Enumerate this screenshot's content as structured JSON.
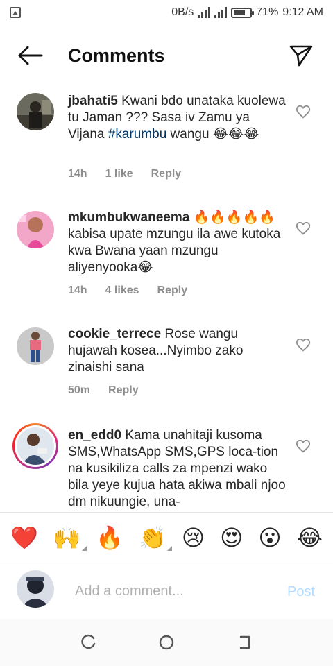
{
  "status_bar": {
    "network_speed": "0B/s",
    "battery": "71%",
    "battery_level": 0.71,
    "time": "9:12 AM"
  },
  "header": {
    "title": "Comments",
    "back_icon": "arrow-left-icon",
    "send_icon": "paper-plane-icon"
  },
  "comments": [
    {
      "username": "jbahati5",
      "text_before": " Kwani bdo unataka kuolewa tu Jaman ??? Sasa iv  Zamu ya Vijana  ",
      "hashtag": "#karumbu",
      "text_after": " wangu 😂😂😂",
      "time": "14h",
      "likes": "1 like",
      "reply": "Reply"
    },
    {
      "username": "mkumbukwaneema",
      "text_before": " 🔥🔥🔥🔥🔥kabisa upate mzungu ila awe kutoka kwa Bwana yaan mzungu aliyenyooka😂",
      "hashtag": "",
      "text_after": "",
      "time": "14h",
      "likes": "4 likes",
      "reply": "Reply"
    },
    {
      "username": "cookie_terrece",
      "text_before": " Rose wangu hujawah kosea...Nyimbo zako zinaishi sana",
      "hashtag": "",
      "text_after": "",
      "time": "50m",
      "likes": "",
      "reply": "Reply"
    },
    {
      "username": "en_edd0",
      "text_before": " Kama unahitaji kusoma SMS,WhatsApp SMS,GPS loca-tion na kusikiliza calls za mpenzi wako bila yeye kujua hata akiwa mbali njoo dm nikuungie, una-",
      "hashtag": "",
      "text_after": "",
      "time": "",
      "likes": "",
      "reply": ""
    }
  ],
  "emoji_bar": [
    "❤️",
    "🙌",
    "🔥",
    "👏",
    "😢",
    "😍",
    "😮",
    "😂"
  ],
  "composer": {
    "placeholder": "Add a comment...",
    "post_label": "Post"
  },
  "colors": {
    "link": "#00376b",
    "muted": "#8e8e8e",
    "post_disabled": "#b3dbff"
  }
}
